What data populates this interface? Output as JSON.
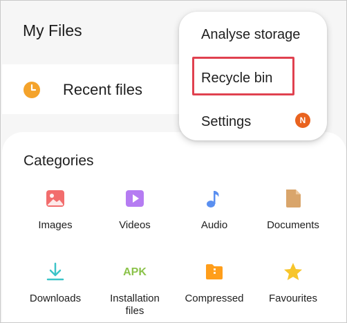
{
  "app": {
    "title": "My Files"
  },
  "recent": {
    "label": "Recent files",
    "icon": "clock-icon",
    "icon_color": "#f4a32b"
  },
  "categories": {
    "title": "Categories",
    "items": [
      {
        "label": "Images",
        "icon": "image-icon",
        "color": "#f26d6d"
      },
      {
        "label": "Videos",
        "icon": "video-icon",
        "color": "#b57cf2"
      },
      {
        "label": "Audio",
        "icon": "music-note-icon",
        "color": "#5a8ff0"
      },
      {
        "label": "Documents",
        "icon": "document-icon",
        "color": "#d9a56b"
      },
      {
        "label": "Downloads",
        "icon": "download-icon",
        "color": "#3cc4c8"
      },
      {
        "label": "Installation files",
        "icon": "apk-icon",
        "icon_text": "APK",
        "color": "#8bc34a"
      },
      {
        "label": "Compressed",
        "icon": "folder-icon",
        "color": "#ff9e1b"
      },
      {
        "label": "Favourites",
        "icon": "star-icon",
        "color": "#f7c52b"
      }
    ]
  },
  "menu": {
    "items": [
      {
        "label": "Analyse storage"
      },
      {
        "label": "Recycle bin",
        "highlighted": true
      },
      {
        "label": "Settings",
        "badge": "N"
      }
    ],
    "highlight_color": "#e0414f",
    "badge_color": "#e9631f"
  }
}
